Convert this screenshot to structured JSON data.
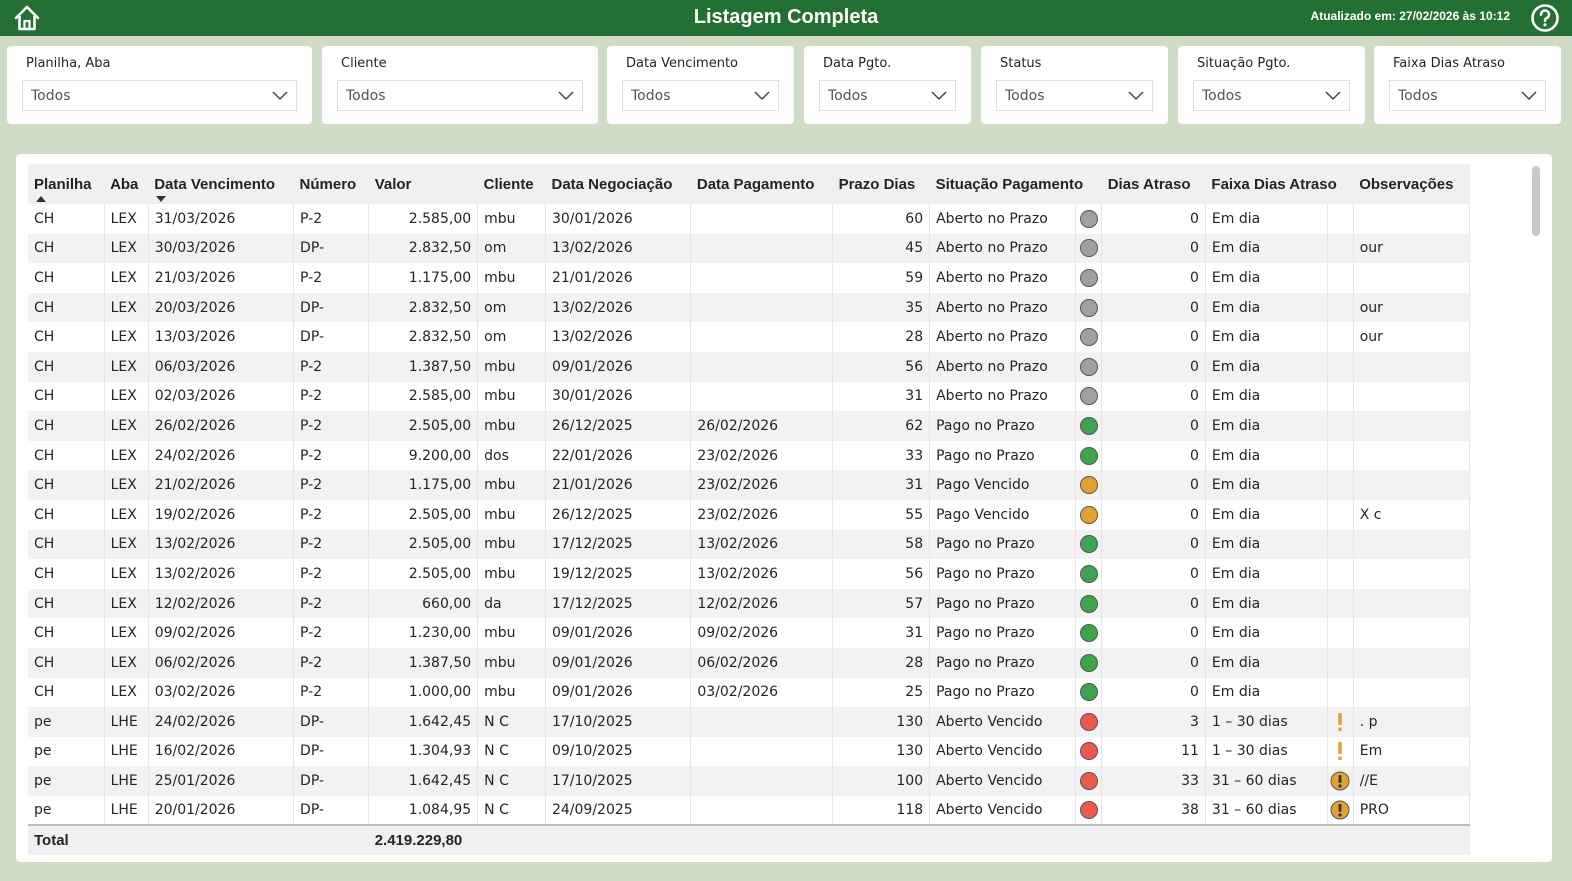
{
  "header": {
    "title": "Listagem Completa",
    "updated": "Atualizado em: 27/02/2026 às 10:12"
  },
  "filters": [
    {
      "label": "Planilha, Aba",
      "value": "Todos"
    },
    {
      "label": "Cliente",
      "value": "Todos"
    },
    {
      "label": "Data Vencimento",
      "value": "Todos"
    },
    {
      "label": "Data Pgto.",
      "value": "Todos"
    },
    {
      "label": "Status",
      "value": "Todos"
    },
    {
      "label": "Situação Pgto.",
      "value": "Todos"
    },
    {
      "label": "Faixa Dias Atraso",
      "value": "Todos"
    }
  ],
  "table": {
    "columns": [
      "Planilha",
      "Aba",
      "Data Vencimento",
      "Número",
      "Valor",
      "Cliente",
      "Data Negociação",
      "Data Pagamento",
      "Prazo Dias",
      "Situação Pagamento",
      "Dias Atraso",
      "Faixa Dias Atraso",
      "Observações"
    ],
    "status_colors": {
      "gray": "#a0a0a0",
      "green": "#3fa34d",
      "orange": "#e3a133",
      "red": "#ec5a4f"
    },
    "rows": [
      [
        "CH",
        "LEX",
        "31/03/2026",
        "P-2",
        "2.585,00",
        "mbu",
        "30/01/2026",
        "",
        "60",
        "Aberto no Prazo",
        "gray",
        "0",
        "Em dia",
        "",
        ""
      ],
      [
        "CH",
        "LEX",
        "30/03/2026",
        "DP-",
        "2.832,50",
        "om",
        "13/02/2026",
        "",
        "45",
        "Aberto no Prazo",
        "gray",
        "0",
        "Em dia",
        "",
        "our"
      ],
      [
        "CH",
        "LEX",
        "21/03/2026",
        "P-2",
        "1.175,00",
        "mbu",
        "21/01/2026",
        "",
        "59",
        "Aberto no Prazo",
        "gray",
        "0",
        "Em dia",
        "",
        ""
      ],
      [
        "CH",
        "LEX",
        "20/03/2026",
        "DP-",
        "2.832,50",
        "om",
        "13/02/2026",
        "",
        "35",
        "Aberto no Prazo",
        "gray",
        "0",
        "Em dia",
        "",
        "our"
      ],
      [
        "CH",
        "LEX",
        "13/03/2026",
        "DP-",
        "2.832,50",
        "om",
        "13/02/2026",
        "",
        "28",
        "Aberto no Prazo",
        "gray",
        "0",
        "Em dia",
        "",
        "our"
      ],
      [
        "CH",
        "LEX",
        "06/03/2026",
        "P-2",
        "1.387,50",
        "mbu",
        "09/01/2026",
        "",
        "56",
        "Aberto no Prazo",
        "gray",
        "0",
        "Em dia",
        "",
        ""
      ],
      [
        "CH",
        "LEX",
        "02/03/2026",
        "P-2",
        "2.585,00",
        "mbu",
        "30/01/2026",
        "",
        "31",
        "Aberto no Prazo",
        "gray",
        "0",
        "Em dia",
        "",
        ""
      ],
      [
        "CH",
        "LEX",
        "26/02/2026",
        "P-2",
        "2.505,00",
        "mbu",
        "26/12/2025",
        "26/02/2026",
        "62",
        "Pago no Prazo",
        "green",
        "0",
        "Em dia",
        "",
        ""
      ],
      [
        "CH",
        "LEX",
        "24/02/2026",
        "P-2",
        "9.200,00",
        "dos",
        "22/01/2026",
        "23/02/2026",
        "33",
        "Pago no Prazo",
        "green",
        "0",
        "Em dia",
        "",
        ""
      ],
      [
        "CH",
        "LEX",
        "21/02/2026",
        "P-2",
        "1.175,00",
        "mbu",
        "21/01/2026",
        "23/02/2026",
        "31",
        "Pago Vencido",
        "orange",
        "0",
        "Em dia",
        "",
        ""
      ],
      [
        "CH",
        "LEX",
        "19/02/2026",
        "P-2",
        "2.505,00",
        "mbu",
        "26/12/2025",
        "23/02/2026",
        "55",
        "Pago Vencido",
        "orange",
        "0",
        "Em dia",
        "",
        "X c"
      ],
      [
        "CH",
        "LEX",
        "13/02/2026",
        "P-2",
        "2.505,00",
        "mbu",
        "17/12/2025",
        "13/02/2026",
        "58",
        "Pago no Prazo",
        "green",
        "0",
        "Em dia",
        "",
        ""
      ],
      [
        "CH",
        "LEX",
        "13/02/2026",
        "P-2",
        "2.505,00",
        "mbu",
        "19/12/2025",
        "13/02/2026",
        "56",
        "Pago no Prazo",
        "green",
        "0",
        "Em dia",
        "",
        ""
      ],
      [
        "CH",
        "LEX",
        "12/02/2026",
        "P-2",
        "660,00",
        "da",
        "17/12/2025",
        "12/02/2026",
        "57",
        "Pago no Prazo",
        "green",
        "0",
        "Em dia",
        "",
        ""
      ],
      [
        "CH",
        "LEX",
        "09/02/2026",
        "P-2",
        "1.230,00",
        "mbu",
        "09/01/2026",
        "09/02/2026",
        "31",
        "Pago no Prazo",
        "green",
        "0",
        "Em dia",
        "",
        ""
      ],
      [
        "CH",
        "LEX",
        "06/02/2026",
        "P-2",
        "1.387,50",
        "mbu",
        "09/01/2026",
        "06/02/2026",
        "28",
        "Pago no Prazo",
        "green",
        "0",
        "Em dia",
        "",
        ""
      ],
      [
        "CH",
        "LEX",
        "03/02/2026",
        "P-2",
        "1.000,00",
        "mbu",
        "09/01/2026",
        "03/02/2026",
        "25",
        "Pago no Prazo",
        "green",
        "0",
        "Em dia",
        "",
        ""
      ],
      [
        "pe",
        "LHE",
        "24/02/2026",
        "DP-",
        "1.642,45",
        "N C",
        "17/10/2025",
        "",
        "130",
        "Aberto Vencido",
        "red",
        "3",
        "1 – 30 dias",
        "exclaim",
        ". p"
      ],
      [
        "pe",
        "LHE",
        "16/02/2026",
        "DP-",
        "1.304,93",
        "N C",
        "09/10/2025",
        "",
        "130",
        "Aberto Vencido",
        "red",
        "11",
        "1 – 30 dias",
        "exclaim",
        "Em"
      ],
      [
        "pe",
        "LHE",
        "25/01/2026",
        "DP-",
        "1.642,45",
        "N C",
        "17/10/2025",
        "",
        "100",
        "Aberto Vencido",
        "red",
        "33",
        "31 – 60 dias",
        "warn-circle",
        "//E"
      ],
      [
        "pe",
        "LHE",
        "20/01/2026",
        "DP-",
        "1.084,95",
        "N C",
        "24/09/2025",
        "",
        "118",
        "Aberto Vencido",
        "red",
        "38",
        "31 – 60 dias",
        "warn-circle",
        "PRO"
      ]
    ],
    "total_label": "Total",
    "total_value": "2.419.229,80"
  }
}
